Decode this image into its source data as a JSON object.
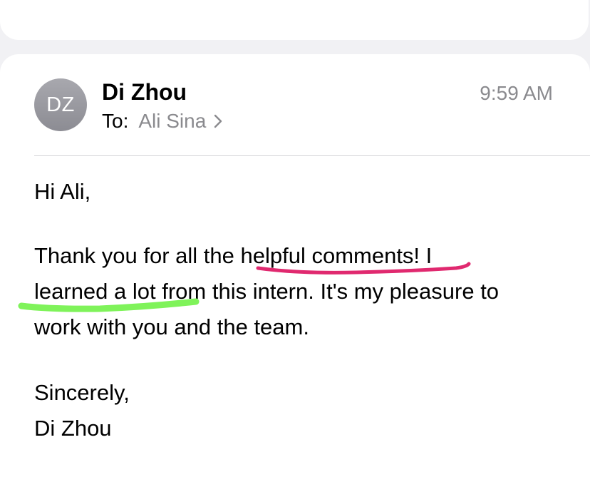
{
  "message": {
    "sender_name": "Di Zhou",
    "sender_initials": "DZ",
    "time": "9:59 AM",
    "to_label": "To:",
    "recipient": "Ali Sina",
    "greeting": "Hi Ali,",
    "body_lines": [
      "Thank you for all the helpful comments! I",
      "learned a lot from this intern. It's my pleasure to",
      "work with you and the team."
    ],
    "closing": "Sincerely,",
    "signature": "Di Zhou"
  },
  "icons": {
    "reply": "reply-arrow-icon",
    "chevron": "chevron-right-icon"
  },
  "colors": {
    "avatar": "#9a9aa0",
    "secondary_text": "#8a8a8e",
    "accent_blue": "#3478f6",
    "annotation_pink": "#e0296f",
    "annotation_green": "#7ff35a"
  }
}
